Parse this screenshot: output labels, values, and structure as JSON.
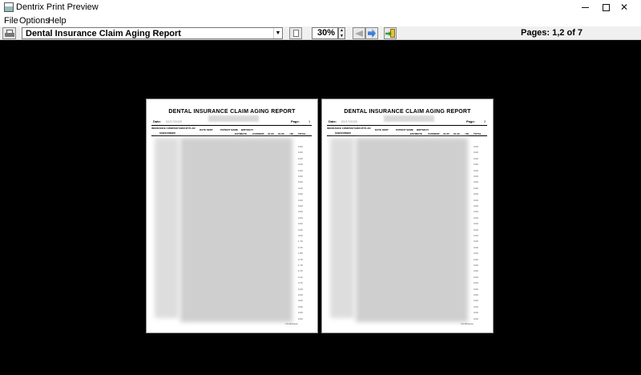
{
  "window": {
    "title": "Dentrix Print Preview",
    "icon": "printer-preview-icon",
    "minimize": "—",
    "maximize": "",
    "close": "✕"
  },
  "menu": [
    "File",
    "Options",
    "Help"
  ],
  "toolbar": {
    "report_name": "Dental Insurance Claim Aging Report",
    "zoom": "30%",
    "page_info": "Pages: 1,2 of 7"
  },
  "pages": [
    {
      "title": "DENTAL INSURANCE CLAIM AGING REPORT",
      "date_label": "Date:",
      "date_value": "02/17/2020",
      "page_label": "Page:",
      "page_number": "1",
      "columns": [
        "INSURANCE COMPANY/GROUP PLAN",
        "SUBSCRIBER",
        "DATE SENT",
        "PATIENT NAME",
        "BIRTHDAY",
        "ESTIMATE",
        "CURRENT",
        "31-60",
        "61-90",
        ">90",
        "TOTAL"
      ],
      "values": [
        "0.00",
        "0.00",
        "0.00",
        "0.00",
        "0.00",
        "0.00",
        "0.00",
        "0.00",
        "0.00",
        "0.00",
        "0.00",
        "0.00",
        "0.00",
        "0.00",
        "0.00",
        "0.00",
        "1.76",
        "0.75",
        "1.86",
        "0.75",
        "1.76",
        "0.75",
        "0.12",
        "0.75",
        "0.00",
        "0.00",
        "0.00",
        "0.00",
        "0.00",
        "0.00"
      ],
      "footer": "--Continued--"
    },
    {
      "title": "DENTAL INSURANCE CLAIM AGING REPORT",
      "date_label": "Date:",
      "date_value": "02/17/2020",
      "page_label": "Page:",
      "page_number": "2",
      "columns": [
        "INSURANCE COMPANY/GROUP PLAN",
        "SUBSCRIBER",
        "DATE SENT",
        "PATIENT NAME",
        "BIRTHDAY",
        "ESTIMATE",
        "CURRENT",
        "31-60",
        "61-90",
        ">90",
        "TOTAL"
      ],
      "values": [
        "0.00",
        "0.00",
        "0.00",
        "0.00",
        "0.00",
        "0.00",
        "0.00",
        "0.00",
        "0.00",
        "0.00",
        "0.00",
        "0.00",
        "0.00",
        "0.00",
        "0.00",
        "0.00",
        "0.00",
        "0.00",
        "0.00",
        "0.00",
        "0.00",
        "0.00",
        "0.00",
        "0.00",
        "0.00",
        "0.00",
        "0.00",
        "0.00",
        "0.00",
        "0.00"
      ],
      "footer": "--Continued--"
    }
  ],
  "colors": {
    "preview_background": "#000000",
    "toolbar": "#f0f0f0",
    "next_arrow": "#1e63c8"
  }
}
